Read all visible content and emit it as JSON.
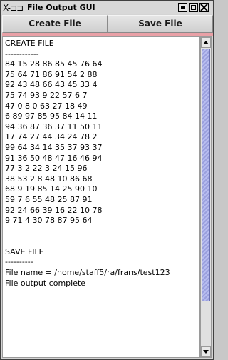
{
  "window": {
    "title": "File Output GUI",
    "title_icon": "X-⊐⊐",
    "controls": [
      "minimize",
      "maximize",
      "close"
    ]
  },
  "toolbar": {
    "create_label": "Create File",
    "save_label": "Save File"
  },
  "output": {
    "lines": [
      "CREATE FILE",
      "------------",
      "84 15 28 86 85 45 76 64",
      "75 64 71 86 91 54 2 88",
      "92 43 48 66 43 45 33 4",
      "75 74 93 9 22 57 6 7",
      "47 0 8 0 63 27 18 49",
      "6 89 97 85 95 84 14 11",
      "94 36 87 36 37 11 50 11",
      "17 74 27 44 34 24 78 2",
      "99 64 34 14 35 37 93 37",
      "91 36 50 48 47 16 46 94",
      "77 3 2 22 3 24 15 96",
      "38 53 2 8 48 10 86 68",
      "68 9 19 85 14 25 90 10",
      "59 7 6 55 48 25 87 91",
      "92 24 66 39 16 22 10 78",
      "9 71 4 30 78 87 95 64",
      "",
      "",
      "SAVE FILE",
      "----------",
      "File name = /home/staff5/ra/frans/test123",
      "File output complete"
    ]
  }
}
